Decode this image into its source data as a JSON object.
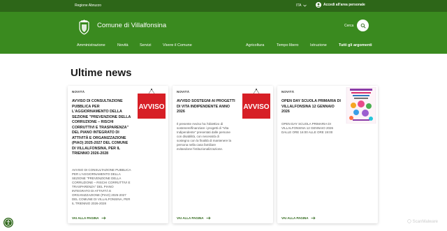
{
  "topbar": {
    "region": "Regione Abruzzo",
    "language": "ITA",
    "login": "Accedi all'area personale"
  },
  "header": {
    "title": "Comune di Villalfonsina",
    "search_label": "Cerca"
  },
  "nav": {
    "main": [
      "Amministrazione",
      "Novità",
      "Servizi",
      "Vivere il Comune"
    ],
    "secondary": [
      "Agricoltura",
      "Tempo libero",
      "Istruzione",
      "Tutti gli argomenti"
    ]
  },
  "page_title": "Ultime news",
  "cards": [
    {
      "category": "NOVITÀ",
      "title": [
        "AVVISO DI CONSULTAZIONE",
        "PUBBLICA PER",
        "L'AGGIORNAMENTO DELLA",
        "SEZIONE \"PREVENZIONE DELLA",
        "CORRUZIONE – RISCHI",
        "CORRUTTIVI E TRASPARENZA\"",
        "DEL PIANO INTEGRATO DI",
        "ATTIVITÀ E ORGANIZZAZIONE",
        "(PIAO) 2025-2027 DEL COMUNE",
        "DI VILLALFONSINA, PER IL",
        "TRIENNIO 2026-2028"
      ],
      "description": [
        "AVVISO DI CONSULTAZIONE PUBBLICA",
        "PER L'AGGIORNAMENTO DELLA",
        "SEZIONE \"PREVENZIONE DELLA",
        "CORRUZIONE – RISCHI CORRUTTIVI E",
        "TRASPARENZA\" DEL PIANO",
        "INTEGRATO DI ATTIVITÀ E",
        "ORGANIZZAZIONE (PIAO) 2025-2027",
        "DEL COMUNE DI VILLALFONSINA, PER",
        "IL TRIENNIO 2026-2028"
      ],
      "link": "VAI ALLA PAGINA",
      "image_text": "AVVISO"
    },
    {
      "category": "NOVITÀ",
      "title": [
        "AVVISO SOSTEGNI AI PROGETTI",
        "DI VITA INDIPENDENTE ANNO",
        "2026"
      ],
      "description": [
        "Il presente Avviso ha l'obiettivo di",
        "sostenere/finanziare i progetti di \"Vita",
        "Indipendente\" presentati dalle persone",
        "con disabilità, con necessità di",
        "sostegno con la finalità di mantenere la",
        "persona nella casa familiare",
        "evitandone l'istituzionalizzazione."
      ],
      "link": "VAI ALLA PAGINA",
      "image_text": "AVVISO"
    },
    {
      "category": "NOVITÀ",
      "title": [
        "OPEN DAY SCUOLA PRIMARIA DI",
        "VILLALFONSINA 12 GENNAIO",
        "2026"
      ],
      "description": [
        "OPEN DAY SCUOLA PRIMARIA DI",
        "VILLALFONSINA 12 GENNAIO 2026",
        "DALLE ORE 16:00 ALLE ORE 19:00"
      ],
      "link": "VAI ALLA PAGINA"
    }
  ],
  "watermark": "ScanMalware",
  "colors": {
    "header": "#3a8a1f",
    "topbar": "#2d6618",
    "accent": "#2d6618",
    "avviso": "#d71f26"
  }
}
